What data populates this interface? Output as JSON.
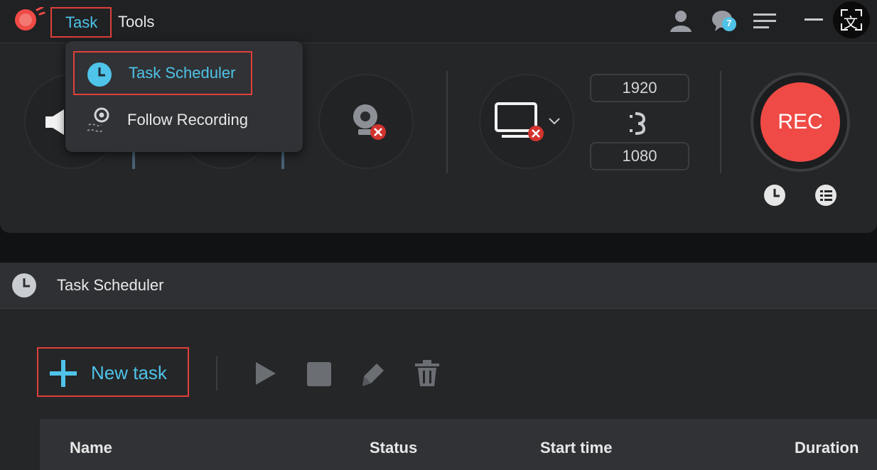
{
  "menubar": {
    "items": [
      {
        "label": "Task",
        "highlighted": true
      },
      {
        "label": "Tools",
        "highlighted": false
      }
    ]
  },
  "titlebar_icons": {
    "notification_count": "7",
    "translate_glyph": "文"
  },
  "dropdown": {
    "items": [
      {
        "label": "Task Scheduler",
        "icon": "clock-icon",
        "highlighted": true
      },
      {
        "label": "Follow Recording",
        "icon": "follow-recording-icon",
        "highlighted": false
      }
    ]
  },
  "recorder": {
    "width": "1920",
    "height": "1080",
    "rec_label": "REC"
  },
  "scheduler": {
    "title": "Task Scheduler",
    "new_task_label": "New task",
    "columns": [
      "Name",
      "Status",
      "Start time",
      "Duration"
    ]
  },
  "colors": {
    "accent": "#4fc3e8",
    "rec_red": "#ef4a45",
    "highlight_border": "#e0403a",
    "bg_dark": "#252628"
  }
}
